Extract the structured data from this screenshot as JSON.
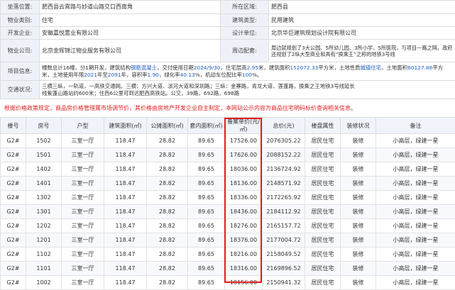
{
  "info": {
    "location_label": "坐落位置:",
    "location_value": "肥西县云霄路与妙道山路交口西南角",
    "district_label": "所在区域:",
    "district_value": "肥西县",
    "use_label": "物业类别:",
    "use_value": "住宅",
    "building_type_label": "建筑类型:",
    "building_type_value": "民用建筑",
    "developer_label": "开发企业:",
    "developer_value": "安徽嘉悦置业有限公司",
    "designer_label": "设计单位:",
    "designer_value": "北京华巨建筑规划设计院有限公司",
    "property_co_label": "物业公司:",
    "property_co_value": "北京金辉锦江物业服务有限公司",
    "surroundings_label": "周边配套:",
    "surroundings_value": "周边就规划了3大公园、5所幼儿园、3所小学、5所医院，与项目一路之隔，政府还规划了2纵大型商业和具有“换乘王”之称的地铁3号线",
    "project_label": "项目信息:",
    "project_value_1": "幢数总计16幢，分1期开发，建筑结构",
    "project_structure": "钢筋混凝土",
    "project_value_2": "，交付使用日期",
    "project_date": "2024/9/30",
    "project_value_3": "，住宅层高",
    "project_height": "2.95",
    "project_value_4": "米，建筑面积",
    "project_area": "152072.33",
    "project_value_5": "平方米，土地性质",
    "project_land": "城镇住宅",
    "project_value_6": "，土地面积",
    "project_land_area": "60127.86",
    "project_value_7": "平方米，土地使用年限",
    "project_start": "2021",
    "project_value_8": "年至",
    "project_end": "2091",
    "project_value_9": "年，容积率",
    "project_far": "1.90",
    "project_value_10": "，绿化率",
    "project_green": "40.13",
    "project_value_11": "%，机动车位配比率",
    "project_parking": "100",
    "project_value_12": "%。",
    "transport_label": "交通状况:",
    "transport_line1": "三横三纵，一轨道，一高铁交通网。三横：方兴大道、派河大道和深圳路；三纵：金寨路，青龙大道、莲蓬路，换乘之王地铁3号线延长",
    "transport_line2": "线紫蓬山路站约600米；住西6公里可到达肥西高铁站。公交，39路，692路，698路"
  },
  "notice": "根据价格政策规定，商品房价格管理属市场调节价，其价格由房地产开发企业自主制定，本网站公示内容为商品住宅明码标价查询相关信息。",
  "table": {
    "headers": [
      "楼号",
      "房号",
      "户型",
      "建筑面积(㎡)",
      "公摊面积(㎡)",
      "套内面积(㎡)",
      "备案单价(元/㎡)",
      "总价(元)",
      "楼盘属性",
      "装修状况",
      "备注"
    ],
    "rows": [
      [
        "G2#",
        "1502",
        "三室一厅",
        "118.47",
        "28.82",
        "89.65",
        "17526.00",
        "2076305.22",
        "居民住宅",
        "装修",
        "小高层，绿建一星"
      ],
      [
        "G2#",
        "1501",
        "三室一厅",
        "118.47",
        "28.82",
        "89.65",
        "17626.00",
        "2088152.22",
        "居民住宅",
        "装修",
        "小高层，绿建一星"
      ],
      [
        "G2#",
        "1402",
        "三室一厅",
        "118.47",
        "28.82",
        "89.65",
        "18036.00",
        "2136724.92",
        "居民住宅",
        "装修",
        "小高层，绿建一星"
      ],
      [
        "G2#",
        "1401",
        "三室一厅",
        "118.47",
        "28.82",
        "89.65",
        "18136.00",
        "2148571.92",
        "居民住宅",
        "装修",
        "小高层，绿建一星"
      ],
      [
        "G2#",
        "1302",
        "三室一厅",
        "118.47",
        "28.82",
        "89.65",
        "18336.00",
        "2172265.92",
        "居民住宅",
        "装修",
        "小高层，绿建一星"
      ],
      [
        "G2#",
        "1301",
        "三室一厅",
        "118.47",
        "28.82",
        "89.65",
        "18436.00",
        "2184112.92",
        "居民住宅",
        "装修",
        "小高层，绿建一星"
      ],
      [
        "G2#",
        "1202",
        "三室一厅",
        "118.47",
        "28.82",
        "89.65",
        "18276.00",
        "2165157.72",
        "居民住宅",
        "装修",
        "小高层，绿建一星"
      ],
      [
        "G2#",
        "1201",
        "三室一厅",
        "118.47",
        "28.82",
        "89.65",
        "18376.00",
        "2177004.72",
        "居民住宅",
        "装修",
        "小高层，绿建一星"
      ],
      [
        "G2#",
        "1102",
        "三室一厅",
        "118.47",
        "28.82",
        "89.65",
        "18216.00",
        "2158049.52",
        "居民住宅",
        "装修",
        "小高层，绿建一星"
      ],
      [
        "G2#",
        "1101",
        "三室一厅",
        "118.47",
        "28.82",
        "89.65",
        "18316.00",
        "2169896.52",
        "居民住宅",
        "装修",
        "小高层，绿建一星"
      ],
      [
        "G2#",
        "1002",
        "三室一厅",
        "118.47",
        "28.82",
        "89.65",
        "18156.00",
        "2150941.32",
        "居民住宅",
        "装修",
        "小高层，绿建一星"
      ]
    ]
  },
  "colors": {
    "highlight": "#e01e1e",
    "notice": "#dd2222",
    "label_bg": "#eef2f8",
    "link_blue": "#1f5fbf"
  }
}
